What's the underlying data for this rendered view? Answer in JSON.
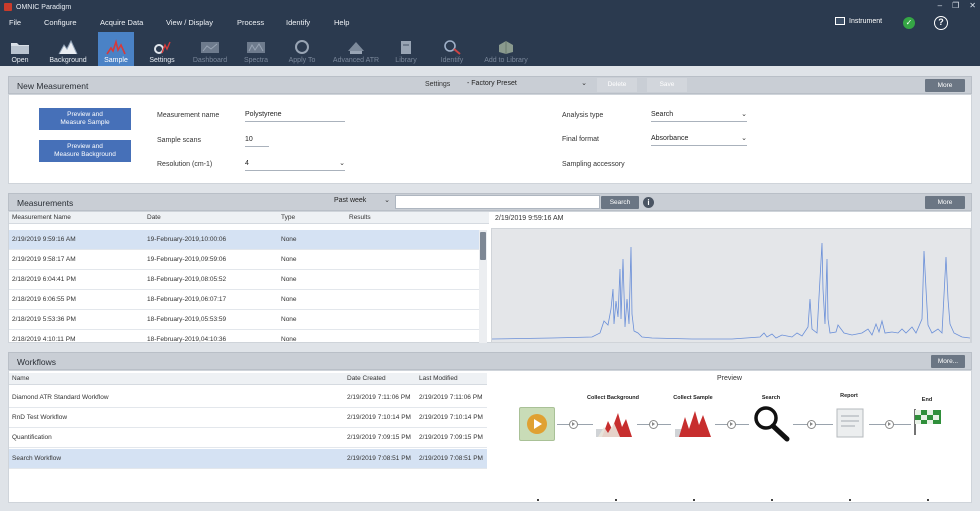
{
  "window": {
    "title": "OMNIC Paradigm"
  },
  "menu": [
    "File",
    "Configure",
    "Acquire Data",
    "View / Display",
    "Process",
    "Identify",
    "Help"
  ],
  "status": {
    "instrument_label": "Instrument"
  },
  "toolbar": {
    "open": "Open",
    "background": "Background",
    "sample": "Sample",
    "settings": "Settings",
    "d1": "Dashboard",
    "d2": "Spectra",
    "d3": "Apply To",
    "d4": "Advanced ATR",
    "d5": "Library",
    "d6": "Identify",
    "d7": "Add to Library"
  },
  "new_measurement": {
    "title": "New Measurement",
    "settings_label": "Settings",
    "settings_value": "- Factory Preset",
    "delete_label": "Delete",
    "save_label": "Save",
    "more_label": "More",
    "preview_sample_line1": "Preview and",
    "preview_sample_line2": "Measure Sample",
    "preview_bg_line1": "Preview and",
    "preview_bg_line2": "Measure Background",
    "measurement_name_label": "Measurement name",
    "measurement_name_value": "Polystyrene",
    "sample_scans_label": "Sample scans",
    "sample_scans_value": "10",
    "resolution_label": "Resolution (cm-1)",
    "resolution_value": "4",
    "analysis_type_label": "Analysis type",
    "analysis_type_value": "Search",
    "final_format_label": "Final format",
    "final_format_value": "Absorbance",
    "sampling_accessory_label": "Sampling accessory"
  },
  "measurements": {
    "title": "Measurements",
    "filter_value": "Past week",
    "search_label": "Search",
    "more_label": "More",
    "columns": {
      "name": "Measurement Name",
      "date": "Date",
      "type": "Type",
      "results": "Results"
    },
    "rows": [
      {
        "name": "2/19/2019 9:59:16 AM",
        "date": "19-February-2019,10:00:06",
        "type": "None"
      },
      {
        "name": "2/19/2019 9:58:17 AM",
        "date": "19-February-2019,09:59:06",
        "type": "None"
      },
      {
        "name": "2/18/2019 6:04:41 PM",
        "date": "18-February-2019,08:05:52",
        "type": "None"
      },
      {
        "name": "2/18/2019 6:06:55 PM",
        "date": "18-February-2019,06:07:17",
        "type": "None"
      },
      {
        "name": "2/18/2019 5:53:36 PM",
        "date": "18-February-2019,05:53:59",
        "type": "None"
      },
      {
        "name": "2/18/2019 4:10:11 PM",
        "date": "18-February-2019,04:10:36",
        "type": "None"
      }
    ],
    "spectrum_title": "2/19/2019 9:59:16 AM"
  },
  "workflows": {
    "title": "Workflows",
    "more_label": "More...",
    "columns": {
      "name": "Name",
      "date_created": "Date Created",
      "last_modified": "Last Modified"
    },
    "rows": [
      {
        "name": "Diamond ATR Standard Workflow",
        "created": "2/19/2019 7:11:06 PM",
        "modified": "2/19/2019 7:11:06 PM"
      },
      {
        "name": "RnD Test Workflow",
        "created": "2/19/2019 7:10:14 PM",
        "modified": "2/19/2019 7:10:14 PM"
      },
      {
        "name": "Quantification",
        "created": "2/19/2019 7:09:15 PM",
        "modified": "2/19/2019 7:09:15 PM"
      },
      {
        "name": "Search Workflow",
        "created": "2/19/2019 7:08:51 PM",
        "modified": "2/19/2019 7:08:51 PM"
      }
    ],
    "preview_title": "Preview",
    "steps": {
      "collect_background": "Collect Background",
      "collect_sample": "Collect Sample",
      "search": "Search",
      "report": "Report",
      "end": "End"
    }
  },
  "colors": {
    "chrome": "#2b3a4f",
    "accent": "#4a82c6",
    "button_blue": "#4670b8",
    "selection": "#d5e2f3",
    "spectrum": "#6a8fd8"
  }
}
